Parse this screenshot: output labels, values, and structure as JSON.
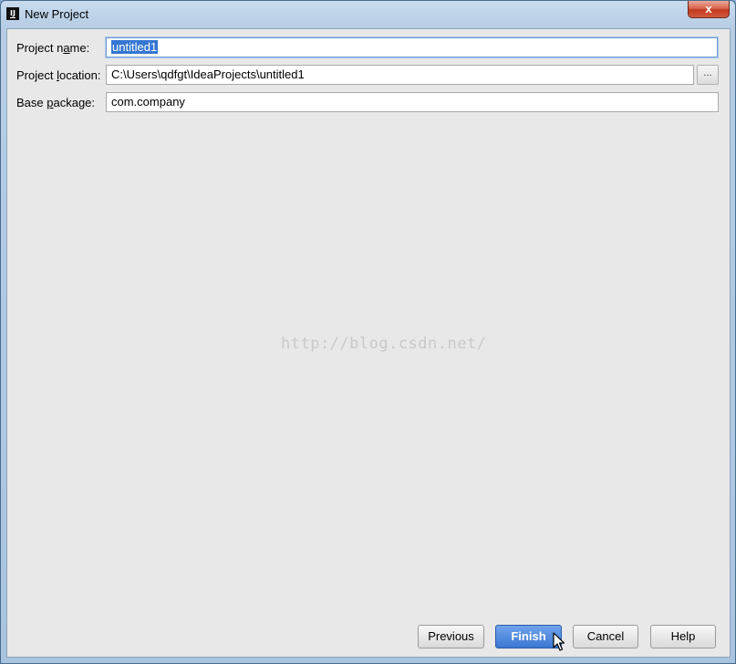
{
  "window": {
    "title": "New Project",
    "app_icon_text": "IJ",
    "close_label": "x"
  },
  "form": {
    "project_name": {
      "label_pre": "Project n",
      "label_mnemonic": "a",
      "label_post": "me:",
      "value": "untitled1"
    },
    "project_location": {
      "label_pre": "Project ",
      "label_mnemonic": "l",
      "label_post": "ocation:",
      "value": "C:\\Users\\qdfgt\\IdeaProjects\\untitled1",
      "browse_label": "..."
    },
    "base_package": {
      "label_pre": "Base ",
      "label_mnemonic": "p",
      "label_post": "ackage:",
      "value": "com.company"
    }
  },
  "watermark": "http://blog.csdn.net/",
  "buttons": {
    "previous": "Previous",
    "finish": "Finish",
    "cancel": "Cancel",
    "help": "Help"
  },
  "colors": {
    "accent": "#3b77d4",
    "selection": "#3476d2",
    "close": "#c2391f"
  }
}
